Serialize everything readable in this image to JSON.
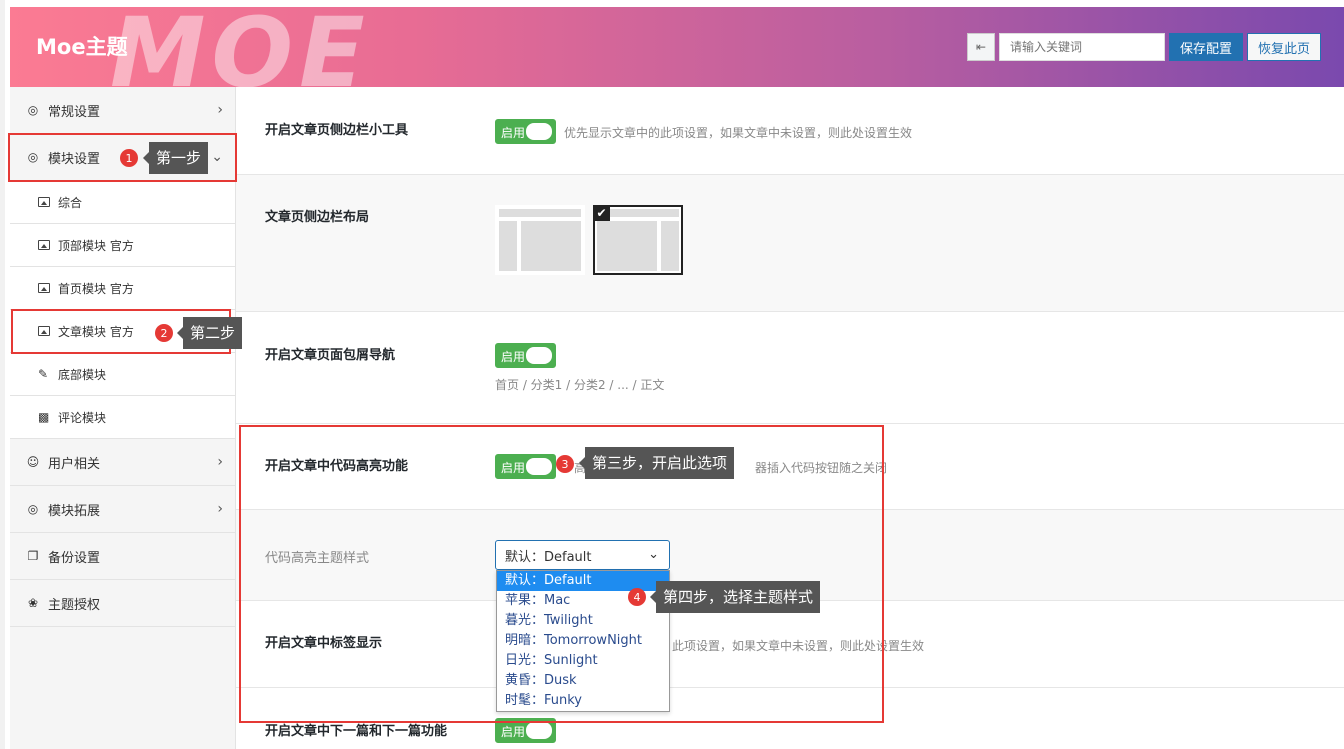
{
  "header": {
    "title": "Moe主题",
    "watermark": "MOE",
    "search_placeholder": "请输入关键词",
    "save_label": "保存配置",
    "reset_label": "恢复此页"
  },
  "sidebar": {
    "items": [
      {
        "label": "常规设置",
        "icon": "target-icon"
      },
      {
        "label": "模块设置",
        "icon": "target-icon"
      },
      {
        "label": "综合",
        "icon": "image-icon"
      },
      {
        "label": "顶部模块 官方",
        "icon": "image-icon"
      },
      {
        "label": "首页模块 官方",
        "icon": "image-icon"
      },
      {
        "label": "文章模块 官方",
        "icon": "image-icon"
      },
      {
        "label": "底部模块",
        "icon": "pencil-icon"
      },
      {
        "label": "评论模块",
        "icon": "comments-icon"
      },
      {
        "label": "用户相关",
        "icon": "user-icon"
      },
      {
        "label": "模块拓展",
        "icon": "target-icon"
      },
      {
        "label": "备份设置",
        "icon": "copy-icon"
      },
      {
        "label": "主题授权",
        "icon": "brand-icon"
      }
    ]
  },
  "settings": {
    "sidebar_widget": {
      "label": "开启文章页侧边栏小工具",
      "toggle": "启用",
      "desc": "优先显示文章中的此项设置，如果文章中未设置，则此处设置生效"
    },
    "sidebar_layout": {
      "label": "文章页侧边栏布局"
    },
    "breadcrumb": {
      "label": "开启文章页面包屑导航",
      "toggle": "启用",
      "desc": "首页 / 分类1 / 分类2 / ... / 正文"
    },
    "code_highlight": {
      "label": "开启文章中代码高亮功能",
      "toggle": "启用",
      "desc_partial": "器插入代码按钮随之关闭",
      "desc_partial_left": "高"
    },
    "code_theme": {
      "label": "代码高亮主题样式",
      "selected": "默认：Default",
      "options": [
        "默认：Default",
        "苹果：Mac",
        "暮光：Twilight",
        "明暗：TomorrowNight",
        "日光：Sunlight",
        "黄昏：Dusk",
        "时髦：Funky"
      ]
    },
    "tags": {
      "label": "开启文章中标签显示",
      "desc": "此项设置，如果文章中未设置，则此处设置生效"
    },
    "prev_next": {
      "label": "开启文章中下一篇和下一篇功能",
      "toggle": "启用"
    }
  },
  "annotations": {
    "step1": {
      "num": "1",
      "text": "第一步"
    },
    "step2": {
      "num": "2",
      "text": "第二步"
    },
    "step3": {
      "num": "3",
      "text": "第三步，开启此选项"
    },
    "step4": {
      "num": "4",
      "text": "第四步，选择主题样式"
    }
  },
  "colors": {
    "accent": "#2271b1",
    "toggle_on": "#4caf50",
    "annotation_red": "#e53935",
    "tooltip_bg": "#555555"
  }
}
